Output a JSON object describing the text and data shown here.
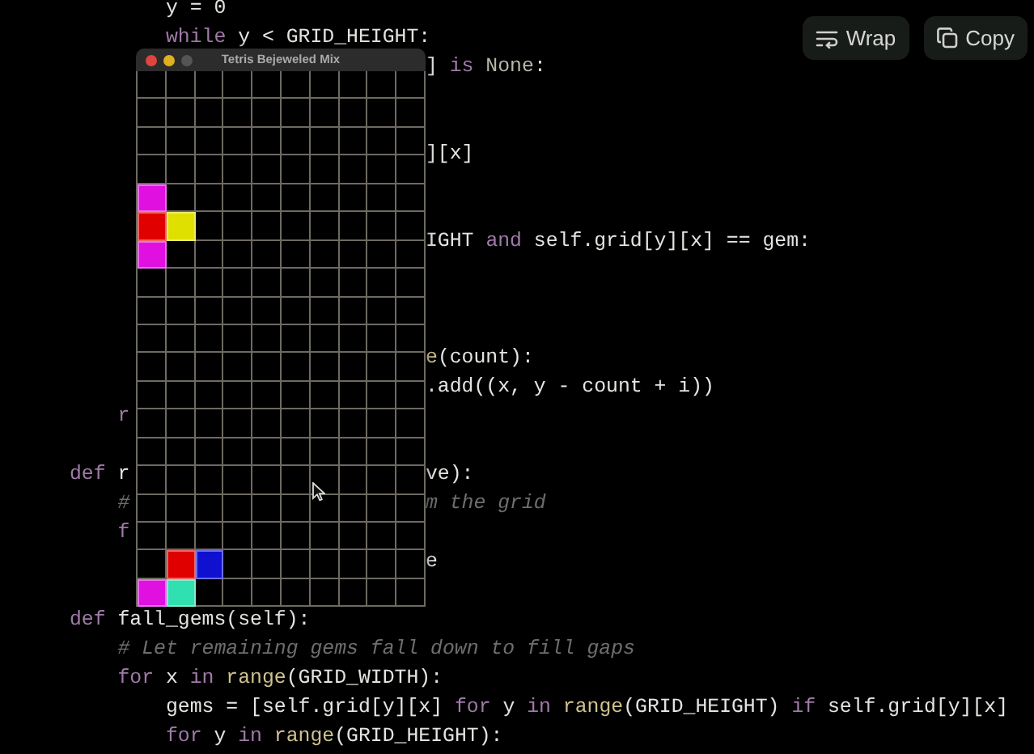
{
  "toolbar": {
    "buttons": [
      {
        "kind": "wrap",
        "label": "Wrap"
      },
      {
        "kind": "copy",
        "label": "Copy"
      }
    ]
  },
  "code": {
    "lines": [
      {
        "kind": "group",
        "children": [
          {
            "kind": "group",
            "children": [
              {
                "kind": "code",
                "left": [
                  {
                    "text": "y = 0",
                    "kind": "plain"
                  }
                ]
              },
              {
                "kind": "code",
                "left": [
                  {
                    "text": "while",
                    "kind": "keyword"
                  },
                  {
                    "text": " y < GRID_HEIGHT:",
                    "kind": "plain"
                  }
                ]
              },
              {
                "kind": "code",
                "right": [
                  {
                    "text": "] ",
                    "kind": "plain"
                  },
                  {
                    "text": "is",
                    "kind": "keyword"
                  },
                  {
                    "text": " None",
                    "kind": "constant"
                  },
                  {
                    "text": ":",
                    "kind": "plain"
                  }
                ]
              },
              {
                "kind": "blank"
              },
              {
                "kind": "blank"
              },
              {
                "kind": "code",
                "right": [
                  {
                    "text": "][x]",
                    "kind": "plain"
                  }
                ]
              },
              {
                "kind": "blank"
              },
              {
                "kind": "blank"
              },
              {
                "kind": "code",
                "right": [
                  {
                    "text": "IGHT ",
                    "kind": "plain"
                  },
                  {
                    "text": "and",
                    "kind": "keyword"
                  },
                  {
                    "text": " self.grid[y][x] == gem:",
                    "kind": "plain"
                  }
                ]
              },
              {
                "kind": "blank"
              },
              {
                "kind": "blank"
              },
              {
                "kind": "blank"
              },
              {
                "kind": "code",
                "right": [
                  {
                    "text": "e",
                    "kind": "builtin"
                  },
                  {
                    "text": "(count):",
                    "kind": "plain"
                  }
                ]
              },
              {
                "kind": "code",
                "right": [
                  {
                    "text": ".add((x, y - count + i))",
                    "kind": "plain"
                  }
                ]
              }
            ]
          },
          {
            "kind": "code",
            "left": [
              {
                "text": "r",
                "kind": "keyword"
              }
            ]
          },
          {
            "kind": "blank"
          }
        ]
      },
      {
        "kind": "code",
        "left": [
          {
            "text": "def",
            "kind": "keyword"
          },
          {
            "text": " r",
            "kind": "plain"
          }
        ],
        "right": [
          {
            "text": "ve):",
            "kind": "plain"
          }
        ],
        "children": [
          {
            "kind": "code",
            "left": [
              {
                "text": "#",
                "kind": "comment"
              }
            ],
            "right": [
              {
                "text": "m the grid",
                "kind": "comment"
              }
            ]
          },
          {
            "kind": "code",
            "left": [
              {
                "text": "f",
                "kind": "keyword"
              }
            ]
          },
          {
            "kind": "code",
            "right": [
              {
                "text": "e",
                "kind": "plain"
              }
            ]
          },
          {
            "kind": "blank"
          }
        ]
      },
      {
        "kind": "code",
        "left": [
          {
            "text": "def",
            "kind": "keyword"
          },
          {
            "text": " fall_gems(self):",
            "kind": "plain"
          }
        ],
        "children": [
          {
            "kind": "code",
            "left": [
              {
                "text": "# Let remaining gems fall down to fill gaps",
                "kind": "comment"
              }
            ]
          },
          {
            "kind": "code",
            "left": [
              {
                "text": "for",
                "kind": "keyword"
              },
              {
                "text": " x ",
                "kind": "plain"
              },
              {
                "text": "in",
                "kind": "keyword"
              },
              {
                "text": " range",
                "kind": "builtin"
              },
              {
                "text": "(GRID_WIDTH):",
                "kind": "plain"
              }
            ],
            "children": [
              {
                "kind": "code",
                "left": [
                  {
                    "text": "gems = [self.grid[y][x] ",
                    "kind": "plain"
                  },
                  {
                    "text": "for",
                    "kind": "keyword"
                  },
                  {
                    "text": " y ",
                    "kind": "plain"
                  },
                  {
                    "text": "in",
                    "kind": "keyword"
                  },
                  {
                    "text": " range",
                    "kind": "builtin"
                  },
                  {
                    "text": "(GRID_HEIGHT) ",
                    "kind": "plain"
                  },
                  {
                    "text": "if",
                    "kind": "keyword"
                  },
                  {
                    "text": " self.grid[y][x]",
                    "kind": "plain"
                  }
                ]
              },
              {
                "kind": "code",
                "left": [
                  {
                    "text": "for",
                    "kind": "keyword"
                  },
                  {
                    "text": " y ",
                    "kind": "plain"
                  },
                  {
                    "text": "in",
                    "kind": "keyword"
                  },
                  {
                    "text": " range",
                    "kind": "builtin"
                  },
                  {
                    "text": "(GRID_HEIGHT):",
                    "kind": "plain"
                  }
                ]
              }
            ]
          }
        ]
      }
    ]
  },
  "game_window": {
    "title": "Tetris Bejeweled Mix",
    "board": [
      [
        {
          "filled": false
        },
        {
          "filled": false
        },
        {
          "filled": false
        },
        {
          "filled": false
        },
        {
          "filled": false
        },
        {
          "filled": false
        },
        {
          "filled": false
        },
        {
          "filled": false
        },
        {
          "filled": false
        },
        {
          "filled": false
        }
      ],
      [
        {
          "filled": false
        },
        {
          "filled": false
        },
        {
          "filled": false
        },
        {
          "filled": false
        },
        {
          "filled": false
        },
        {
          "filled": false
        },
        {
          "filled": false
        },
        {
          "filled": false
        },
        {
          "filled": false
        },
        {
          "filled": false
        }
      ],
      [
        {
          "filled": false
        },
        {
          "filled": false
        },
        {
          "filled": false
        },
        {
          "filled": false
        },
        {
          "filled": false
        },
        {
          "filled": false
        },
        {
          "filled": false
        },
        {
          "filled": false
        },
        {
          "filled": false
        },
        {
          "filled": false
        }
      ],
      [
        {
          "filled": false
        },
        {
          "filled": false
        },
        {
          "filled": false
        },
        {
          "filled": false
        },
        {
          "filled": false
        },
        {
          "filled": false
        },
        {
          "filled": false
        },
        {
          "filled": false
        },
        {
          "filled": false
        },
        {
          "filled": false
        }
      ],
      [
        {
          "filled": true,
          "color": "#e010e0"
        },
        {
          "filled": false
        },
        {
          "filled": false
        },
        {
          "filled": false
        },
        {
          "filled": false
        },
        {
          "filled": false
        },
        {
          "filled": false
        },
        {
          "filled": false
        },
        {
          "filled": false
        },
        {
          "filled": false
        }
      ],
      [
        {
          "filled": true,
          "color": "#e00000"
        },
        {
          "filled": true,
          "color": "#e0e000"
        },
        {
          "filled": false
        },
        {
          "filled": false
        },
        {
          "filled": false
        },
        {
          "filled": false
        },
        {
          "filled": false
        },
        {
          "filled": false
        },
        {
          "filled": false
        },
        {
          "filled": false
        }
      ],
      [
        {
          "filled": true,
          "color": "#e010e0"
        },
        {
          "filled": false
        },
        {
          "filled": false
        },
        {
          "filled": false
        },
        {
          "filled": false
        },
        {
          "filled": false
        },
        {
          "filled": false
        },
        {
          "filled": false
        },
        {
          "filled": false
        },
        {
          "filled": false
        }
      ],
      [
        {
          "filled": false
        },
        {
          "filled": false
        },
        {
          "filled": false
        },
        {
          "filled": false
        },
        {
          "filled": false
        },
        {
          "filled": false
        },
        {
          "filled": false
        },
        {
          "filled": false
        },
        {
          "filled": false
        },
        {
          "filled": false
        }
      ],
      [
        {
          "filled": false
        },
        {
          "filled": false
        },
        {
          "filled": false
        },
        {
          "filled": false
        },
        {
          "filled": false
        },
        {
          "filled": false
        },
        {
          "filled": false
        },
        {
          "filled": false
        },
        {
          "filled": false
        },
        {
          "filled": false
        }
      ],
      [
        {
          "filled": false
        },
        {
          "filled": false
        },
        {
          "filled": false
        },
        {
          "filled": false
        },
        {
          "filled": false
        },
        {
          "filled": false
        },
        {
          "filled": false
        },
        {
          "filled": false
        },
        {
          "filled": false
        },
        {
          "filled": false
        }
      ],
      [
        {
          "filled": false
        },
        {
          "filled": false
        },
        {
          "filled": false
        },
        {
          "filled": false
        },
        {
          "filled": false
        },
        {
          "filled": false
        },
        {
          "filled": false
        },
        {
          "filled": false
        },
        {
          "filled": false
        },
        {
          "filled": false
        }
      ],
      [
        {
          "filled": false
        },
        {
          "filled": false
        },
        {
          "filled": false
        },
        {
          "filled": false
        },
        {
          "filled": false
        },
        {
          "filled": false
        },
        {
          "filled": false
        },
        {
          "filled": false
        },
        {
          "filled": false
        },
        {
          "filled": false
        }
      ],
      [
        {
          "filled": false
        },
        {
          "filled": false
        },
        {
          "filled": false
        },
        {
          "filled": false
        },
        {
          "filled": false
        },
        {
          "filled": false
        },
        {
          "filled": false
        },
        {
          "filled": false
        },
        {
          "filled": false
        },
        {
          "filled": false
        }
      ],
      [
        {
          "filled": false
        },
        {
          "filled": false
        },
        {
          "filled": false
        },
        {
          "filled": false
        },
        {
          "filled": false
        },
        {
          "filled": false
        },
        {
          "filled": false
        },
        {
          "filled": false
        },
        {
          "filled": false
        },
        {
          "filled": false
        }
      ],
      [
        {
          "filled": false
        },
        {
          "filled": false
        },
        {
          "filled": false
        },
        {
          "filled": false
        },
        {
          "filled": false
        },
        {
          "filled": false
        },
        {
          "filled": false
        },
        {
          "filled": false
        },
        {
          "filled": false
        },
        {
          "filled": false
        }
      ],
      [
        {
          "filled": false
        },
        {
          "filled": false
        },
        {
          "filled": false
        },
        {
          "filled": false
        },
        {
          "filled": false
        },
        {
          "filled": false
        },
        {
          "filled": false
        },
        {
          "filled": false
        },
        {
          "filled": false
        },
        {
          "filled": false
        }
      ],
      [
        {
          "filled": false
        },
        {
          "filled": false
        },
        {
          "filled": false
        },
        {
          "filled": false
        },
        {
          "filled": false
        },
        {
          "filled": false
        },
        {
          "filled": false
        },
        {
          "filled": false
        },
        {
          "filled": false
        },
        {
          "filled": false
        }
      ],
      [
        {
          "filled": false
        },
        {
          "filled": true,
          "color": "#e00000"
        },
        {
          "filled": true,
          "color": "#1010d0"
        },
        {
          "filled": false
        },
        {
          "filled": false
        },
        {
          "filled": false
        },
        {
          "filled": false
        },
        {
          "filled": false
        },
        {
          "filled": false
        },
        {
          "filled": false
        }
      ],
      [
        {
          "filled": true,
          "color": "#e010e0"
        },
        {
          "filled": true,
          "color": "#30e0b0"
        },
        {
          "filled": false
        },
        {
          "filled": false
        },
        {
          "filled": false
        },
        {
          "filled": false
        },
        {
          "filled": false
        },
        {
          "filled": false
        },
        {
          "filled": false
        },
        {
          "filled": false
        }
      ]
    ]
  }
}
